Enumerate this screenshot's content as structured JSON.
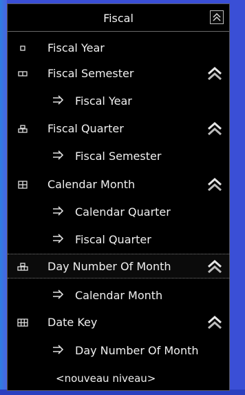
{
  "panel": {
    "title": "Fiscal",
    "collapse_icon": "collapse-up-icon"
  },
  "levels": [
    {
      "label": "Fiscal Year",
      "icon": "level-1-icon",
      "has_up_button": false,
      "relations": []
    },
    {
      "label": "Fiscal Semester",
      "icon": "level-2-icon",
      "has_up_button": true,
      "relations": [
        "Fiscal Year"
      ]
    },
    {
      "label": "Fiscal Quarter",
      "icon": "level-3-icon",
      "has_up_button": true,
      "relations": [
        "Fiscal Semester"
      ]
    },
    {
      "label": "Calendar Month",
      "icon": "level-4-icon",
      "has_up_button": true,
      "relations": [
        "Calendar Quarter",
        "Fiscal Quarter"
      ]
    },
    {
      "label": "Day Number Of Month",
      "icon": "level-5-icon",
      "has_up_button": true,
      "selected": true,
      "relations": [
        "Calendar Month"
      ]
    },
    {
      "label": "Date Key",
      "icon": "level-6-icon",
      "has_up_button": true,
      "relations": [
        "Day Number Of Month"
      ]
    }
  ],
  "new_level_label": "<nouveau niveau>",
  "colors": {
    "background": "#3a4fd6",
    "panel": "#000000",
    "text": "#f0f0f0"
  }
}
